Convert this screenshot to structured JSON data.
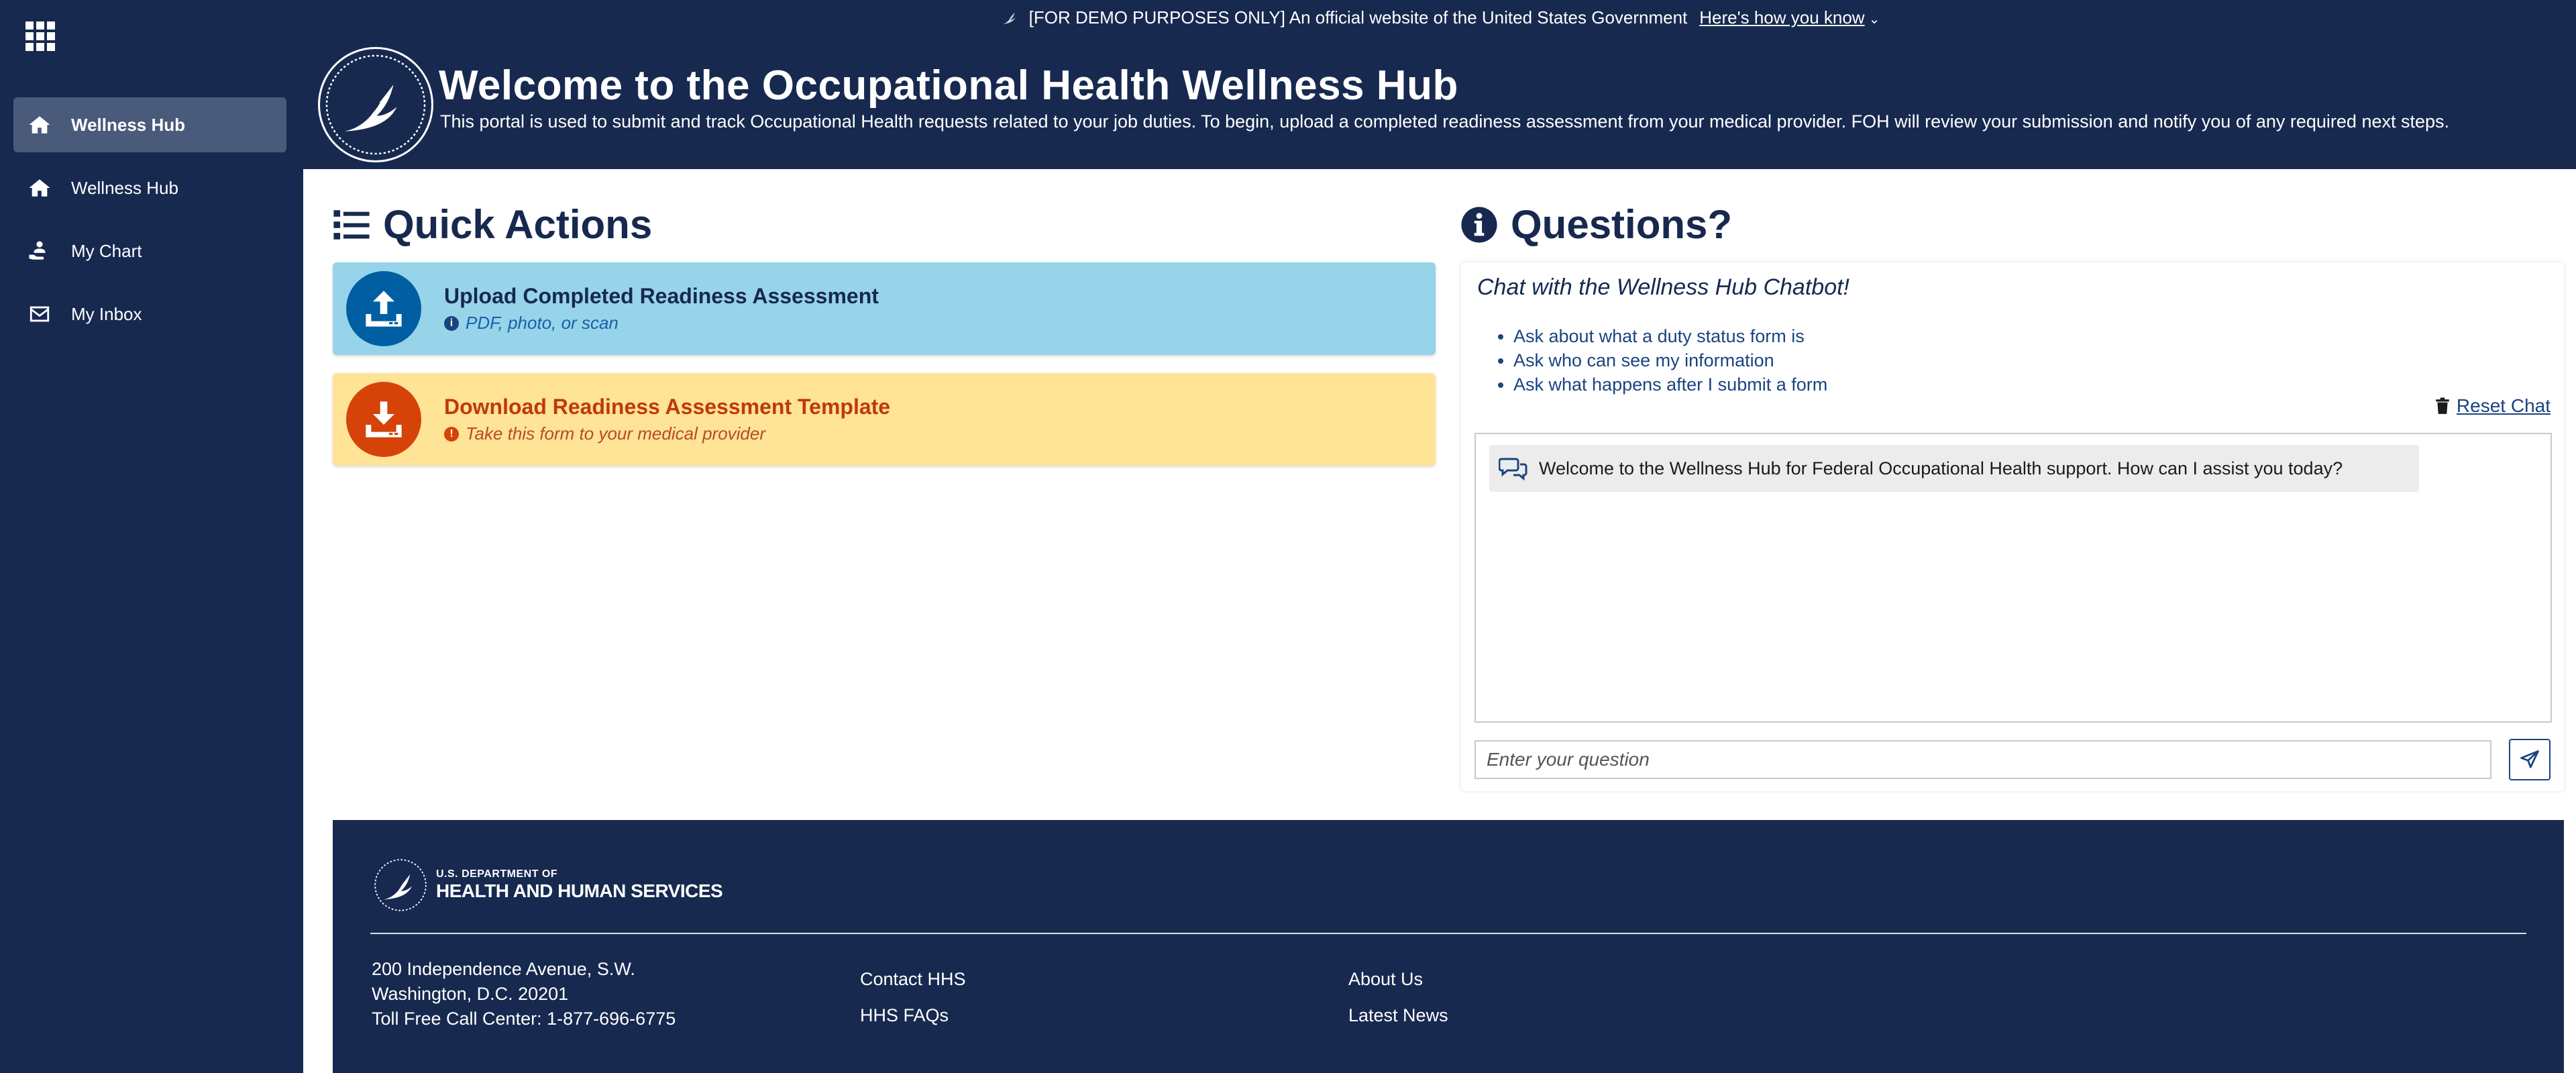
{
  "sidebar": {
    "items": [
      {
        "label": "Wellness Hub",
        "icon": "home-icon",
        "active": true
      },
      {
        "label": "Wellness Hub",
        "icon": "home-icon",
        "active": false
      },
      {
        "label": "My Chart",
        "icon": "hand-user-icon",
        "active": false
      },
      {
        "label": "My Inbox",
        "icon": "envelope-icon",
        "active": false
      }
    ]
  },
  "header": {
    "banner_text": "[FOR DEMO PURPOSES ONLY] An official website of the United States Government",
    "banner_link": "Here's how you know",
    "title": "Welcome to the Occupational Health Wellness Hub",
    "description": "This portal is used to submit and track Occupational Health requests related to your job duties. To begin, upload a completed readiness assessment from your medical provider. FOH will review your submission and notify you of any required next steps."
  },
  "quick_actions": {
    "title": "Quick Actions",
    "upload": {
      "title": "Upload Completed Readiness Assessment",
      "subtitle": "PDF, photo, or scan"
    },
    "download": {
      "title": "Download Readiness Assessment Template",
      "subtitle": "Take this form to your medical provider"
    }
  },
  "questions": {
    "title": "Questions?",
    "intro": "Chat with the Wellness Hub Chatbot!",
    "suggestions": [
      "Ask about what a duty status form is",
      "Ask who can see my information",
      "Ask what happens after I submit a form"
    ],
    "reset_label": "Reset Chat",
    "messages": [
      {
        "text": "Welcome to the Wellness Hub for Federal Occupational Health support. How can I assist you today?"
      }
    ],
    "input_placeholder": "Enter your question"
  },
  "footer": {
    "logo_small": "U.S. DEPARTMENT OF",
    "logo_big": "HEALTH AND HUMAN SERVICES",
    "address": [
      "200 Independence Avenue, S.W.",
      "Washington, D.C. 20201",
      "Toll Free Call Center: 1-877-696-6775"
    ],
    "links_col1": [
      "Contact HHS",
      "HHS FAQs"
    ],
    "links_col2": [
      "About Us",
      "Latest News"
    ]
  },
  "colors": {
    "navy": "#17294f",
    "sidebar_active": "#4a5a7a",
    "upload_card": "#97d4ea",
    "download_card": "#ffe396",
    "accent_blue": "#005ea2",
    "accent_orange": "#d54309"
  }
}
